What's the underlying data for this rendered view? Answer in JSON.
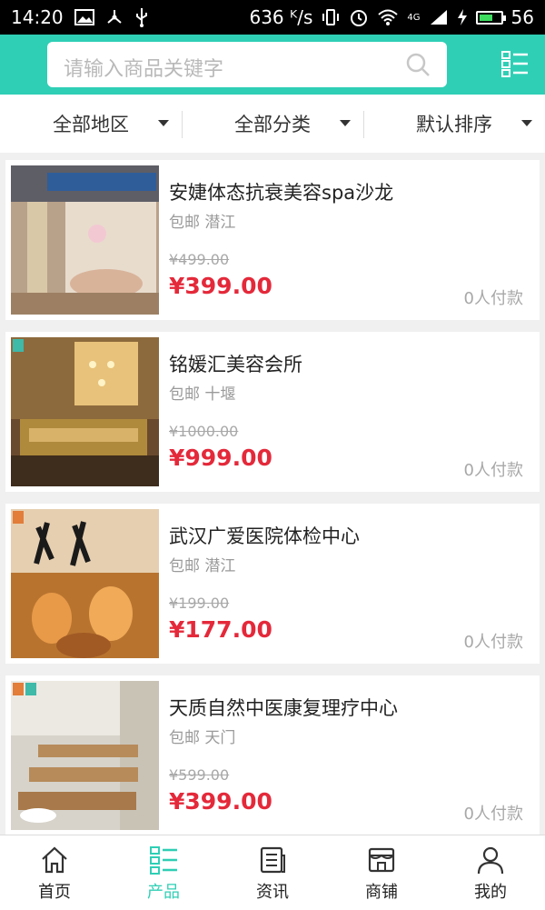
{
  "status_bar": {
    "time": "14:20",
    "speed": "636 ᴷ/s",
    "signal_label": "4G",
    "battery_level": "56"
  },
  "search": {
    "placeholder": "请输入商品关键字"
  },
  "filters": [
    {
      "label": "全部地区"
    },
    {
      "label": "全部分类"
    },
    {
      "label": "默认排序"
    }
  ],
  "products": [
    {
      "title": "安婕体态抗衰美容spa沙龙",
      "shipping": "包邮",
      "city": "潜江",
      "old_price": "¥499.00",
      "price": "¥399.00",
      "paid": "0人付款"
    },
    {
      "title": "铭媛汇美容会所",
      "shipping": "包邮",
      "city": "十堰",
      "old_price": "¥1000.00",
      "price": "¥999.00",
      "paid": "0人付款"
    },
    {
      "title": "武汉广爱医院体检中心",
      "shipping": "包邮",
      "city": "潜江",
      "old_price": "¥199.00",
      "price": "¥177.00",
      "paid": "0人付款"
    },
    {
      "title": "天质自然中医康复理疗中心",
      "shipping": "包邮",
      "city": "天门",
      "old_price": "¥599.00",
      "price": "¥399.00",
      "paid": "0人付款"
    }
  ],
  "tabs": [
    {
      "label": "首页",
      "icon": "home-icon",
      "active": false
    },
    {
      "label": "产品",
      "icon": "list-icon",
      "active": true
    },
    {
      "label": "资讯",
      "icon": "news-icon",
      "active": false
    },
    {
      "label": "商铺",
      "icon": "store-icon",
      "active": false
    },
    {
      "label": "我的",
      "icon": "user-icon",
      "active": false
    }
  ],
  "colors": {
    "accent": "#2fcfb5",
    "price_red": "#e4293a"
  }
}
